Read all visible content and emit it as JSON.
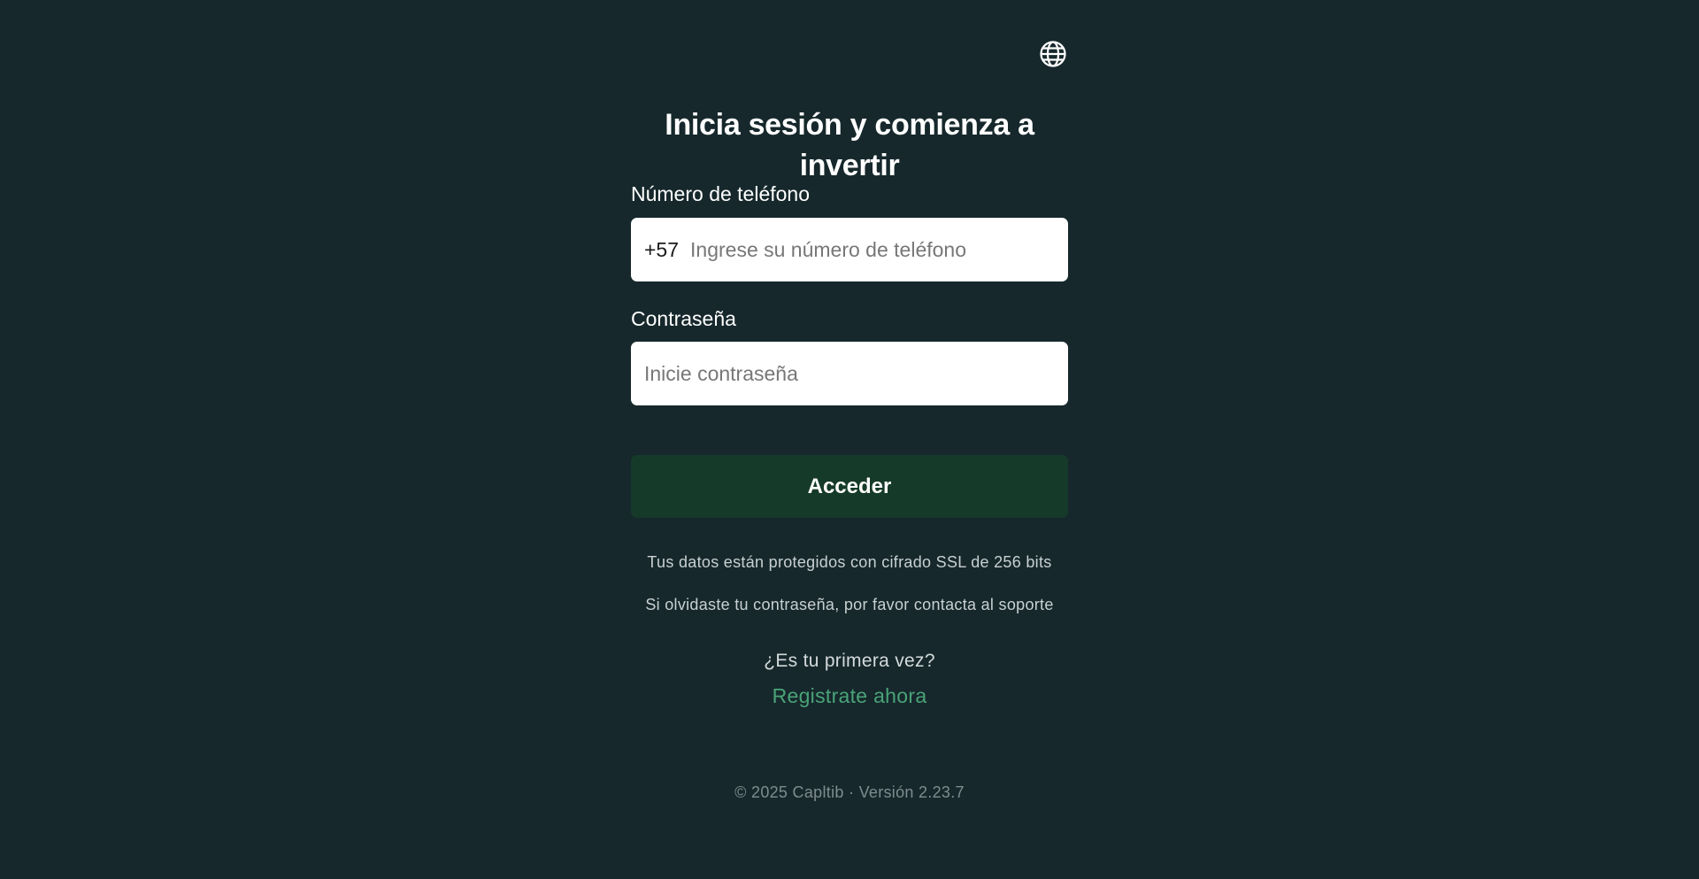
{
  "header": {
    "language_icon": "globe-icon"
  },
  "login": {
    "title": "Inicia sesión y comienza a invertir",
    "phone": {
      "label": "Número de teléfono",
      "prefix": "+57",
      "placeholder": "Ingrese su número de teléfono",
      "value": ""
    },
    "password": {
      "label": "Contraseña",
      "placeholder": "Inicie contraseña",
      "value": ""
    },
    "submit_label": "Acceder",
    "ssl_note": "Tus datos están protegidos con cifrado SSL de 256 bits",
    "forgot_note": "Si olvidaste tu contraseña, por favor contacta al soporte",
    "first_time_text": "¿Es tu primera vez?",
    "register_link": "Registrate ahora"
  },
  "footer": {
    "text": "© 2025 Capltib · Versión 2.23.7"
  },
  "colors": {
    "background": "#16282c",
    "button": "#163a29",
    "link": "#4aa378",
    "input_bg": "#ffffff"
  }
}
